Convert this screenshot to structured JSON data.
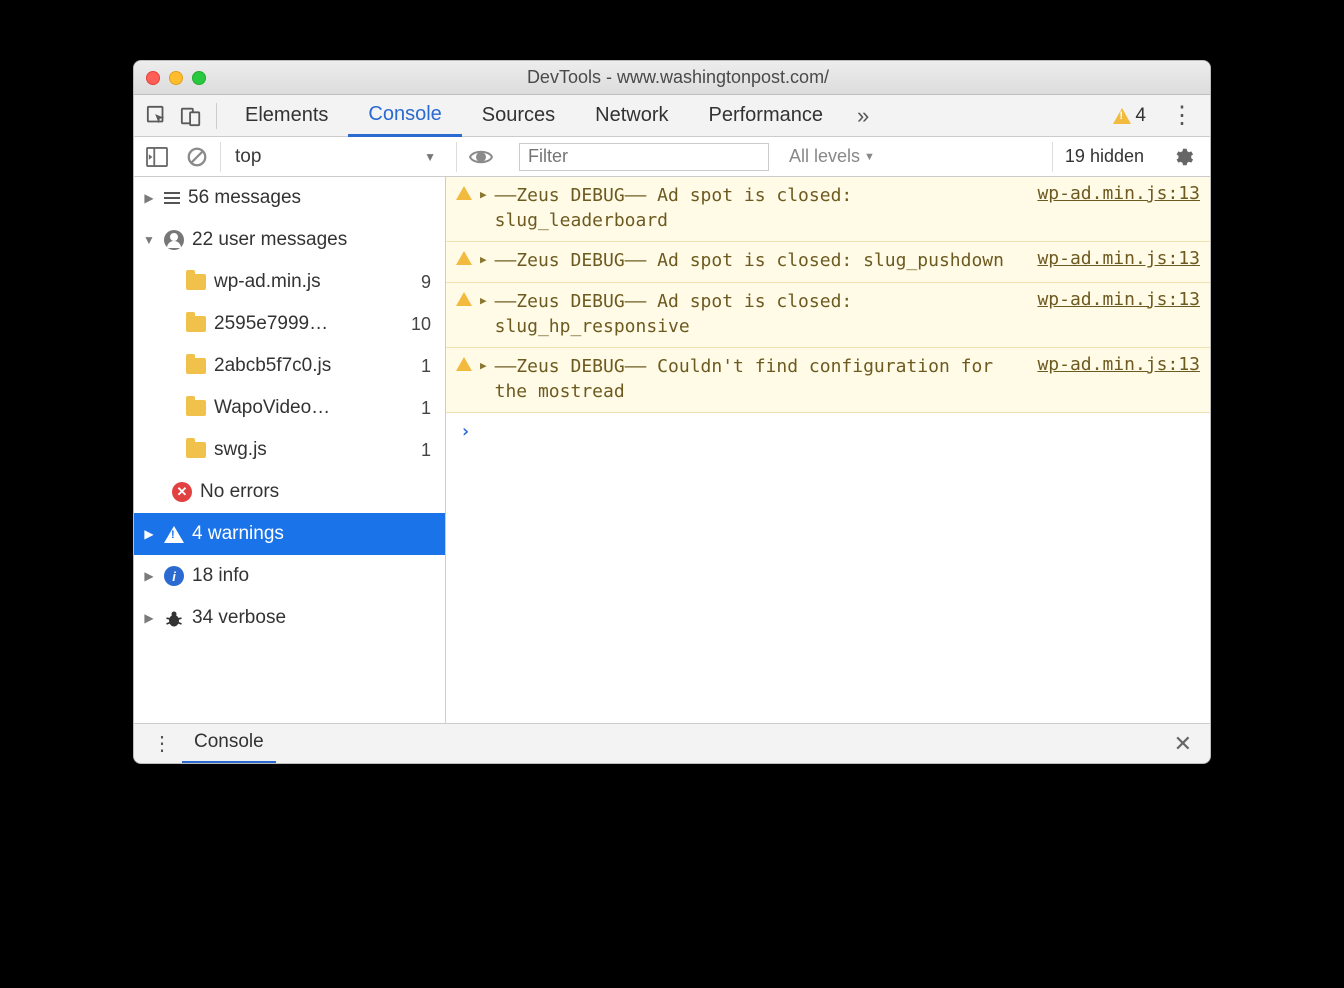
{
  "window": {
    "title": "DevTools - www.washingtonpost.com/"
  },
  "tabs": {
    "elements": "Elements",
    "console": "Console",
    "sources": "Sources",
    "network": "Network",
    "performance": "Performance",
    "more": "»",
    "warning_count": "4"
  },
  "toolbar": {
    "context": "top",
    "filter_placeholder": "Filter",
    "levels": "All levels",
    "hidden": "19 hidden"
  },
  "sidebar": {
    "messages": {
      "label": "56 messages"
    },
    "user_messages": {
      "label": "22 user messages"
    },
    "files": [
      {
        "name": "wp-ad.min.js",
        "count": "9"
      },
      {
        "name": "2595e7999…",
        "count": "10"
      },
      {
        "name": "2abcb5f7c0.js",
        "count": "1"
      },
      {
        "name": "WapoVideo…",
        "count": "1"
      },
      {
        "name": "swg.js",
        "count": "1"
      }
    ],
    "errors": {
      "label": "No errors"
    },
    "warnings": {
      "label": "4 warnings"
    },
    "info": {
      "label": "18 info"
    },
    "verbose": {
      "label": "34 verbose"
    }
  },
  "messages": [
    {
      "text": "––Zeus DEBUG–– Ad spot is closed: slug_leaderboard",
      "src": "wp-ad.min.js:13"
    },
    {
      "text": "––Zeus DEBUG–– Ad spot is closed: slug_pushdown",
      "src": "wp-ad.min.js:13"
    },
    {
      "text": "––Zeus DEBUG–– Ad spot is closed: slug_hp_responsive",
      "src": "wp-ad.min.js:13"
    },
    {
      "text": "––Zeus DEBUG–– Couldn't find configuration for the mostread",
      "src": "wp-ad.min.js:13"
    }
  ],
  "drawer": {
    "tab": "Console"
  }
}
